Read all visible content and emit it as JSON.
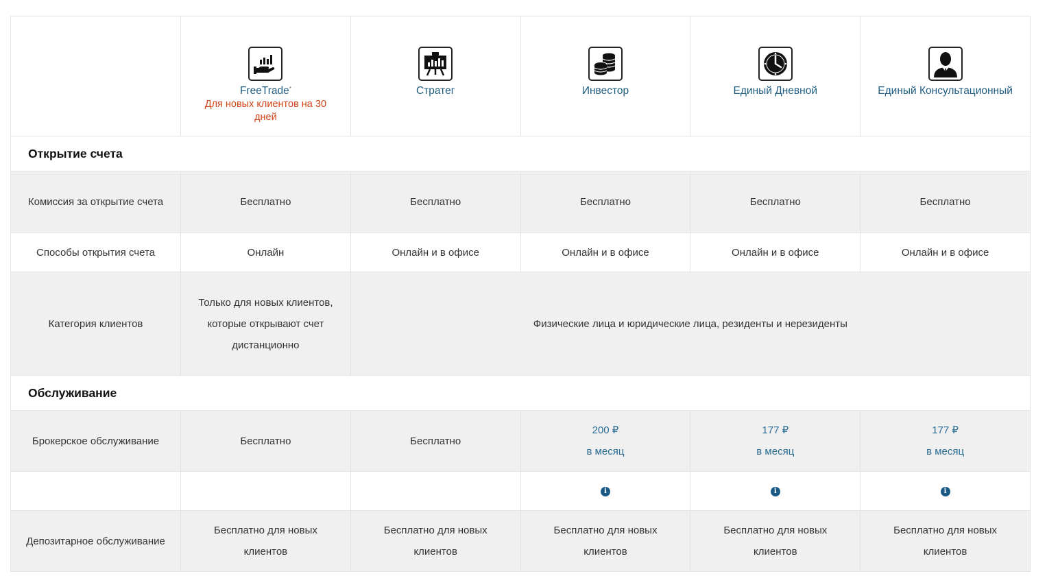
{
  "plans": [
    {
      "name": "FreeTrade",
      "sup": "*",
      "promo": "Для новых клиентов на 30 дней",
      "icon": "chart-hand-icon"
    },
    {
      "name": "Стратег",
      "sup": "",
      "promo": "",
      "icon": "presentation-board-icon"
    },
    {
      "name": "Инвестор",
      "sup": "",
      "promo": "",
      "icon": "coins-stack-icon"
    },
    {
      "name": "Единый Дневной",
      "sup": "",
      "promo": "",
      "icon": "clock-icon"
    },
    {
      "name": "Единый Консультационный",
      "sup": "",
      "promo": "",
      "icon": "person-icon"
    }
  ],
  "sections": {
    "opening": "Открытие счета",
    "service": "Обслуживание"
  },
  "rows": {
    "commission": {
      "label": "Комиссия за открытие счета",
      "values": [
        "Бесплатно",
        "Бесплатно",
        "Бесплатно",
        "Бесплатно",
        "Бесплатно"
      ]
    },
    "methods": {
      "label": "Способы открытия счета",
      "values": [
        "Онлайн",
        "Онлайн и в офисе",
        "Онлайн и в офисе",
        "Онлайн и в офисе",
        "Онлайн и в офисе"
      ]
    },
    "category": {
      "label": "Категория клиентов",
      "first": "Только для новых клиентов, которые открывают счет дистанционно",
      "rest": "Физические лица и юридические лица, резиденты и нерезиденты"
    },
    "broker": {
      "label": "Брокерское обслуживание",
      "values": [
        {
          "price": "Бесплатно",
          "period": ""
        },
        {
          "price": "Бесплатно",
          "period": ""
        },
        {
          "price": "200 ₽",
          "period": "в месяц"
        },
        {
          "price": "177 ₽",
          "period": "в месяц"
        },
        {
          "price": "177 ₽",
          "period": "в месяц"
        }
      ],
      "info_symbol": "i"
    },
    "depository": {
      "label": "Депозитарное обслуживание",
      "values": [
        "Бесплатно для новых клиентов",
        "Бесплатно для новых клиентов",
        "Бесплатно для новых клиентов",
        "Бесплатно для новых клиентов",
        "Бесплатно для новых клиентов"
      ]
    }
  },
  "colors": {
    "plan_name": "#1f5c7f",
    "promo": "#d24317",
    "price": "#2a6c93",
    "row_gray": "#f0f0f0",
    "info_icon": "#1c5a86"
  }
}
